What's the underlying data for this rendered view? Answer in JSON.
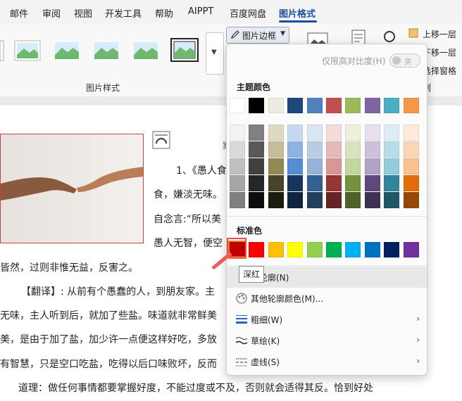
{
  "tabs": [
    "邮件",
    "审阅",
    "视图",
    "开发工具",
    "帮助",
    "AIPPT",
    "百度网盘",
    "图片格式"
  ],
  "active_tab": "图片格式",
  "ribbon": {
    "picture_styles_label": "图片样式",
    "border_button": "图片边框",
    "right_items": [
      "上移一层",
      "下移一层",
      "选择窗格",
      "列"
    ]
  },
  "document": {
    "lines": [
      "1、《愚人食",
      "食，嫌淡无味。",
      "自念言:“所以美",
      "愚人无智，便空",
      "皆然，过则非惟无益，反害之。",
      "【翻译】: 从前有个愚蠢的人，到朋友家。主",
      "无味，主人听到后，就加了些盐。味道就非常鲜美",
      "美，是由于加了盐，加少许一点便这样好吃，多放",
      "有智慧，只是空口吃盐，吃得以后口味败坏，反而",
      "道理：做任何事情都要掌握好度，不能过度或不及，否则就会适得其反。恰到好处"
    ],
    "side_char": "案"
  },
  "menu": {
    "high_contrast": "仅限高对比度(H)",
    "toggle_text": "关",
    "theme_colors_title": "主题颜色",
    "standard_colors_title": "标准色",
    "theme_top": [
      "#ffffff",
      "#000000",
      "#eeece1",
      "#1f497d",
      "#4f81bd",
      "#c0504d",
      "#9bbb59",
      "#8064a2",
      "#4bacc6",
      "#f79646"
    ],
    "theme_shades": [
      [
        "#f2f2f2",
        "#808080",
        "#ddd9c3",
        "#c6d9f0",
        "#dbe5f1",
        "#f2dcdb",
        "#ebf1dd",
        "#e5e0ec",
        "#dbeef3",
        "#fdeada"
      ],
      [
        "#d9d9d9",
        "#595959",
        "#c4bd97",
        "#8db3e2",
        "#b8cce4",
        "#e5b9b7",
        "#d7e3bc",
        "#ccc1d9",
        "#b7dde8",
        "#fbd5b5"
      ],
      [
        "#bfbfbf",
        "#404040",
        "#938953",
        "#548dd4",
        "#95b3d7",
        "#d99694",
        "#c3d69b",
        "#b2a2c7",
        "#92cddc",
        "#fac08f"
      ],
      [
        "#a6a6a6",
        "#262626",
        "#494429",
        "#17365d",
        "#366092",
        "#953734",
        "#76923c",
        "#5f497a",
        "#31859b",
        "#e36c09"
      ],
      [
        "#7f7f7f",
        "#0d0d0d",
        "#1d1b10",
        "#0f243e",
        "#244061",
        "#632423",
        "#4f6128",
        "#3f3151",
        "#205867",
        "#974806"
      ]
    ],
    "standard": [
      "#c00000",
      "#ff0000",
      "#ffc000",
      "#ffff00",
      "#92d050",
      "#00b050",
      "#00b0f0",
      "#0070c0",
      "#002060",
      "#7030a0"
    ],
    "items": [
      {
        "label": "无轮廓(N)",
        "arrow": false
      },
      {
        "label": "其他轮廓颜色(M)...",
        "arrow": false
      },
      {
        "label": "粗细(W)",
        "arrow": true
      },
      {
        "label": "草绘(K)",
        "arrow": true
      },
      {
        "label": "虚线(S)",
        "arrow": true
      }
    ],
    "tooltip": "深红"
  }
}
